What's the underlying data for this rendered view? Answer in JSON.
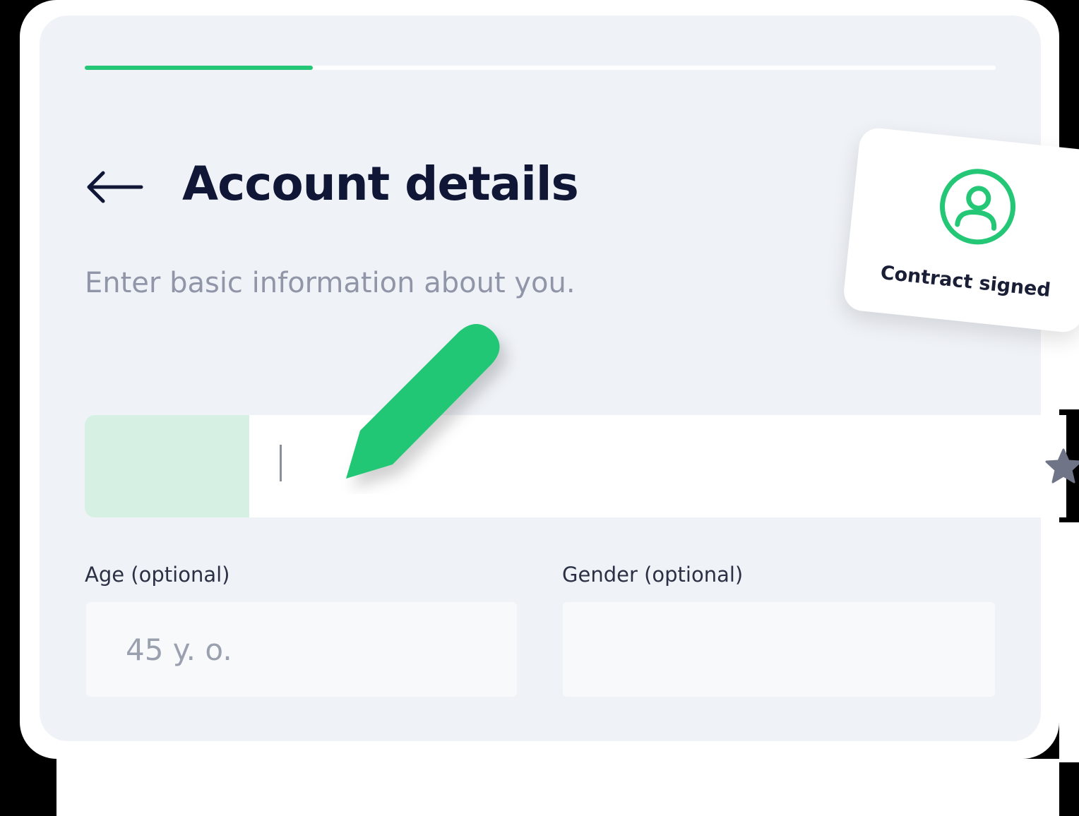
{
  "colors": {
    "accent": "#23c775",
    "accent_light": "#d6f1e3",
    "title": "#0f1636",
    "muted_text": "#9095a8",
    "card_background": "#eff2f7"
  },
  "progress": {
    "fraction": 0.25
  },
  "header": {
    "back_icon": "arrow-left-icon",
    "title": "Account details",
    "subtitle": "Enter basic information about you."
  },
  "name_input": {
    "value": "",
    "decoration_icon": "pencil-icon"
  },
  "fields": {
    "age": {
      "label": "Age (optional)",
      "placeholder": "45 y. o.",
      "value": ""
    },
    "gender": {
      "label": "Gender (optional)",
      "placeholder": "",
      "value": ""
    }
  },
  "contract_card": {
    "icon": "user-circle-icon",
    "label": "Contract signed"
  },
  "side_icon": "star-icon"
}
